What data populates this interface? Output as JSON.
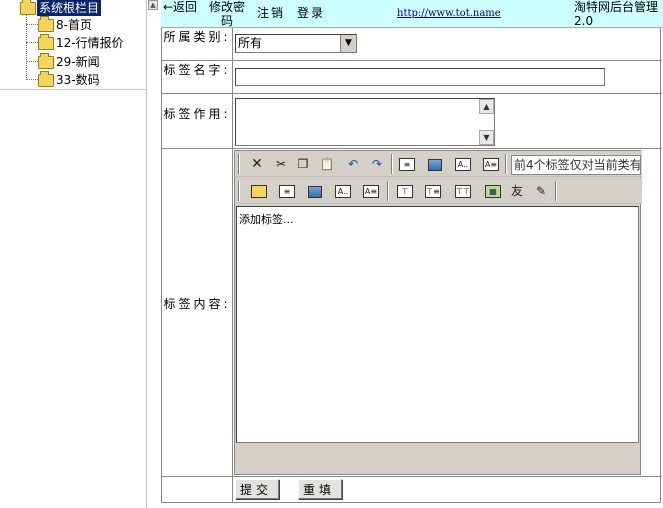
{
  "tree": {
    "root": "系统根栏目",
    "items": [
      {
        "label": "8-首页"
      },
      {
        "label": "12-行情报价"
      },
      {
        "label": "29-新闻"
      },
      {
        "label": "33-数码"
      }
    ]
  },
  "header": {
    "back": "←返回",
    "change_password": "修改密码",
    "logout": "注销",
    "login": "登录",
    "url": "http://www.tot.name",
    "title": "淘特网后台管理2.0"
  },
  "form": {
    "category_label": "所属类别:",
    "category_value": "所有",
    "name_label": "标签名字:",
    "name_value": "",
    "purpose_label": "标签作用:",
    "purpose_value": "",
    "content_label": "标签内容:",
    "editor_hint": "前4个标签仅对当前类有",
    "editor_content": "添加标签...",
    "friend_button": "友"
  },
  "buttons": {
    "submit": "提交",
    "reset": "重填"
  }
}
